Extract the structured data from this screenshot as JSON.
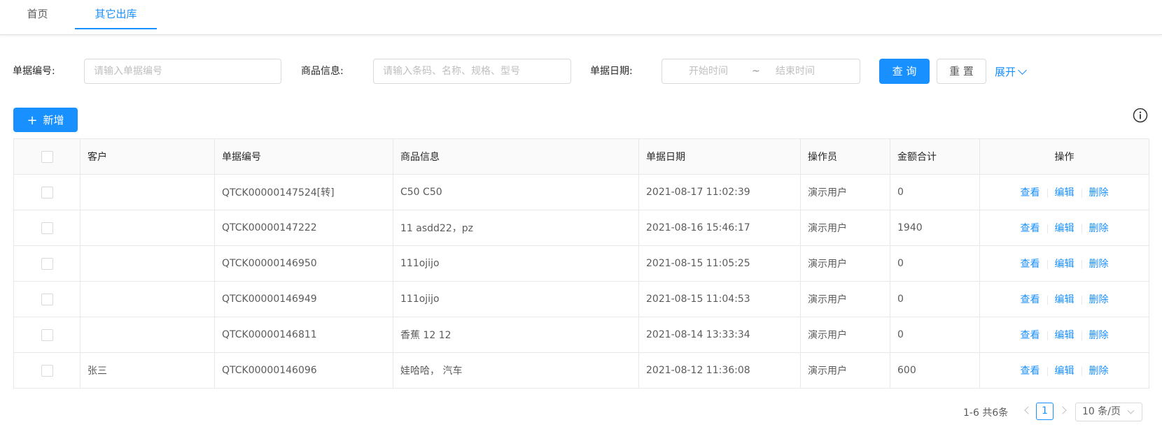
{
  "tabs": [
    {
      "label": "首页"
    },
    {
      "label": "其它出库"
    }
  ],
  "search": {
    "bill_no_label": "单据编号:",
    "bill_no_placeholder": "请输入单据编号",
    "goods_label": "商品信息:",
    "goods_placeholder": "请输入条码、名称、规格、型号",
    "date_label": "单据日期:",
    "date_start_placeholder": "开始时间",
    "date_separator": "~",
    "date_end_placeholder": "结束时间",
    "query_label": "查 询",
    "reset_label": "重 置",
    "expand_label": "展开"
  },
  "toolbar": {
    "add_label": "新增"
  },
  "table": {
    "columns": [
      "客户",
      "单据编号",
      "商品信息",
      "单据日期",
      "操作员",
      "金额合计",
      "操作"
    ],
    "rows": [
      {
        "customer": "",
        "bill_no": "QTCK00000147524[转]",
        "goods": "C50 C50",
        "date": "2021-08-17 11:02:39",
        "operator": "演示用户",
        "amount": "0"
      },
      {
        "customer": "",
        "bill_no": "QTCK00000147222",
        "goods": "11 asdd22，pz",
        "date": "2021-08-16 15:46:17",
        "operator": "演示用户",
        "amount": "1940"
      },
      {
        "customer": "",
        "bill_no": "QTCK00000146950",
        "goods": "111ojijo",
        "date": "2021-08-15 11:05:25",
        "operator": "演示用户",
        "amount": "0"
      },
      {
        "customer": "",
        "bill_no": "QTCK00000146949",
        "goods": "111ojijo",
        "date": "2021-08-15 11:04:53",
        "operator": "演示用户",
        "amount": "0"
      },
      {
        "customer": "",
        "bill_no": "QTCK00000146811",
        "goods": "香蕉 12 12",
        "date": "2021-08-14 13:33:34",
        "operator": "演示用户",
        "amount": "0"
      },
      {
        "customer": "张三",
        "bill_no": "QTCK00000146096",
        "goods": "娃哈哈， 汽车",
        "date": "2021-08-12 11:36:08",
        "operator": "演示用户",
        "amount": "600"
      }
    ],
    "actions": {
      "view": "查看",
      "edit": "编辑",
      "delete": "删除"
    }
  },
  "pagination": {
    "total_text": "1-6 共6条",
    "current_page": "1",
    "page_size": "10 条/页"
  },
  "colors": {
    "primary": "#1890ff",
    "border": "#e8e8e8",
    "header_bg": "#fafafa"
  },
  "icons": {
    "info": "info-circle-icon",
    "add": "plus-icon",
    "expand": "chevron-down-icon"
  }
}
